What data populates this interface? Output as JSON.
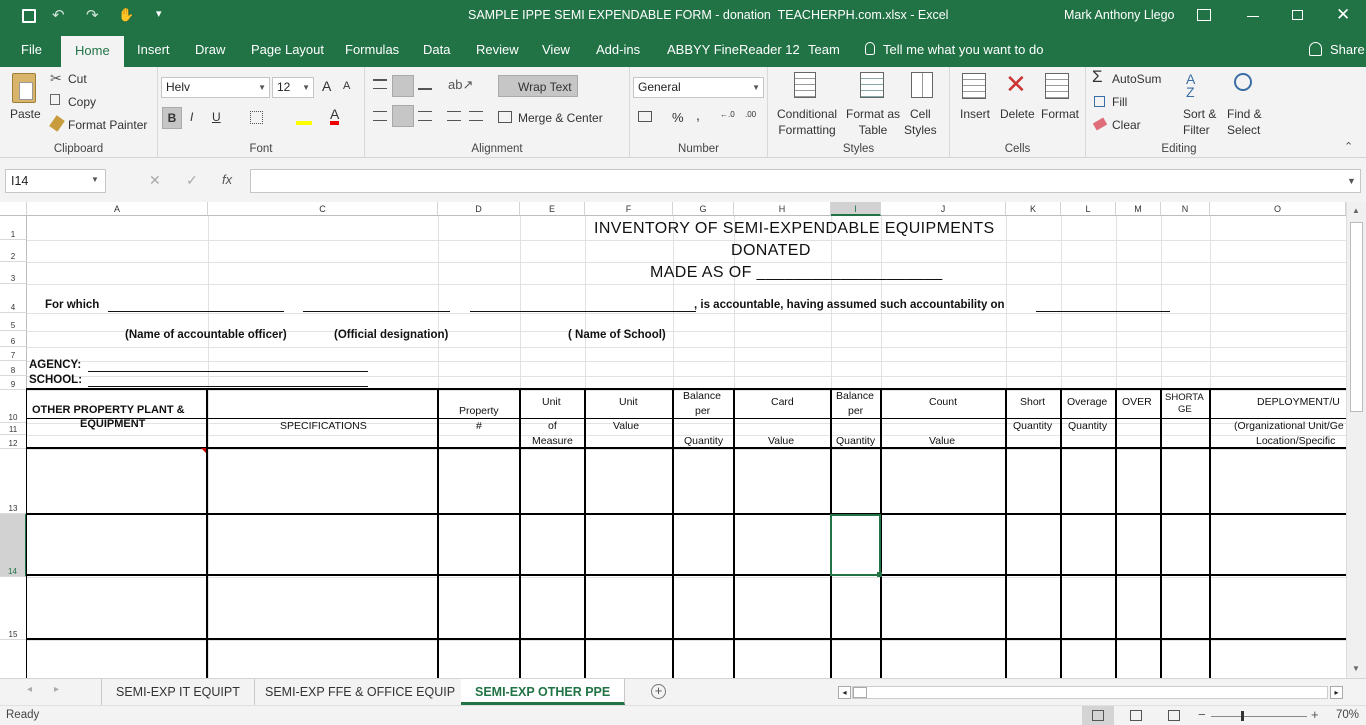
{
  "title": {
    "text": "SAMPLE IPPE SEMI EXPENDABLE FORM - donation  TEACHERPH.com.xlsx - Excel",
    "user": "Mark Anthony Llego"
  },
  "tabs": [
    "File",
    "Home",
    "Insert",
    "Draw",
    "Page Layout",
    "Formulas",
    "Data",
    "Review",
    "View",
    "Add-ins",
    "ABBYY FineReader 12",
    "Team"
  ],
  "tell_me": "Tell me what you want to do",
  "share": "Share",
  "ribbon": {
    "clipboard": {
      "label": "Clipboard",
      "paste": "Paste",
      "cut": "Cut",
      "copy": "Copy",
      "format_painter": "Format Painter"
    },
    "font": {
      "label": "Font",
      "name": "Helv",
      "size": "12",
      "bold": "B",
      "italic": "I",
      "underline": "U"
    },
    "alignment": {
      "label": "Alignment",
      "wrap": "Wrap Text",
      "merge": "Merge & Center"
    },
    "number": {
      "label": "Number",
      "format": "General",
      "percent": "%"
    },
    "styles": {
      "label": "Styles",
      "conditional": "Conditional",
      "conditional2": "Formatting",
      "format_as": "Format as",
      "format_as2": "Table",
      "cell": "Cell",
      "cell2": "Styles"
    },
    "cells": {
      "label": "Cells",
      "insert": "Insert",
      "delete": "Delete",
      "format": "Format"
    },
    "editing": {
      "label": "Editing",
      "autosum": "AutoSum",
      "fill": "Fill",
      "clear": "Clear",
      "sort": "Sort &",
      "sort2": "Filter",
      "find": "Find &",
      "find2": "Select"
    }
  },
  "namebox": "I14",
  "fx": "fx",
  "columns": [
    "A",
    "C",
    "D",
    "E",
    "F",
    "G",
    "H",
    "I",
    "J",
    "K",
    "L",
    "M",
    "N",
    "O"
  ],
  "rows": [
    "1",
    "2",
    "3",
    "4",
    "5",
    "6",
    "7",
    "8",
    "9",
    "10",
    "11",
    "12",
    "13",
    "14",
    "15"
  ],
  "sheet": {
    "title1": "INVENTORY OF SEMI-EXPENDABLE EQUIPMENTS",
    "title2": "DONATED",
    "title3": "MADE AS OF ____________________",
    "for_which": "For which",
    "accountable": ", is accountable, having assumed such accountability on",
    "name_officer": "(Name of accountable officer)",
    "official_designation": "(Official designation)",
    "name_school": "( Name of School)",
    "agency": "AGENCY: ",
    "school": "SCHOOL: ",
    "h_opp1": "OTHER PROPERTY PLANT &",
    "h_opp2": "EQUIPMENT",
    "h_spec": "SPECIFICATIONS",
    "h_prop1": "Property",
    "h_prop2": "#",
    "h_unit1": "Unit",
    "h_unit2": "of",
    "h_unit3": "Measure",
    "h_uval1": "Unit",
    "h_uval2": "Value",
    "h_bal1": "Balance",
    "h_bal2": "per",
    "h_bal3": "Quantity",
    "h_card": "Card",
    "h_cardval": "Value",
    "h_bal4": "Balance",
    "h_bal5": "per",
    "h_bal6": "Quantity",
    "h_count": "Count",
    "h_countval": "Value",
    "h_short1": "Short",
    "h_short2": "Quantity",
    "h_over1": "Overage",
    "h_over2": "Quantity",
    "h_overm": "OVER",
    "h_shortage1": "SHORTA",
    "h_shortage2": "GE",
    "h_deploy1": "DEPLOYMENT/U",
    "h_deploy2": "(Organizational Unit/Ge",
    "h_deploy3": "Location/Specific"
  },
  "sheet_tabs": [
    "SEMI-EXP IT EQUIPT",
    "SEMI-EXP FFE & OFFICE EQUIP",
    "SEMI-EXP OTHER PPE"
  ],
  "status": {
    "ready": "Ready",
    "zoom": "70%"
  },
  "colors": {
    "accent": "#217346"
  }
}
